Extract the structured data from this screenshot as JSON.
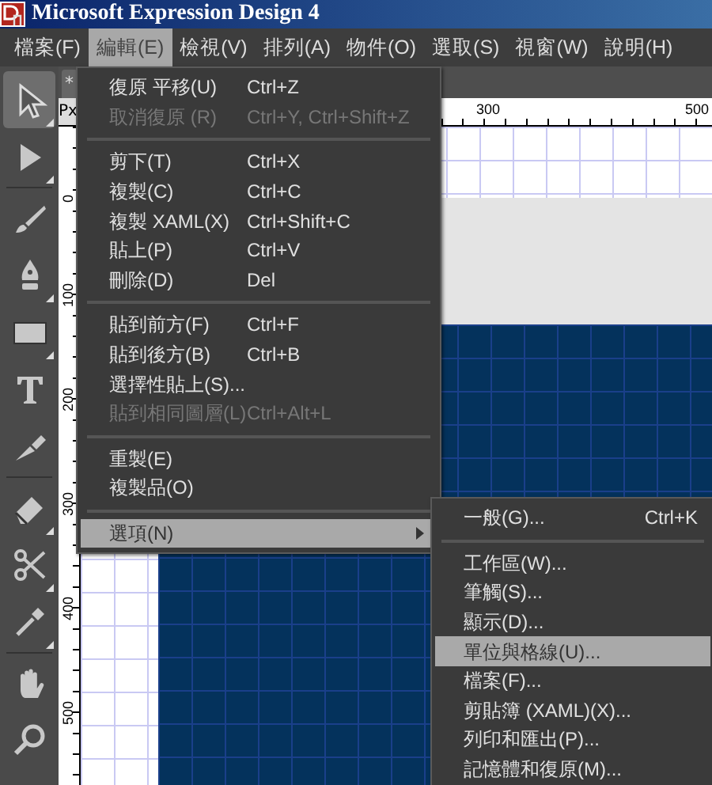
{
  "window": {
    "title": "Microsoft Expression Design 4"
  },
  "menubar": [
    {
      "label": "檔案(F)",
      "selected": false
    },
    {
      "label": "編輯(E)",
      "selected": true
    },
    {
      "label": "檢視(V)",
      "selected": false
    },
    {
      "label": "排列(A)",
      "selected": false
    },
    {
      "label": "物件(O)",
      "selected": false
    },
    {
      "label": "選取(S)",
      "selected": false
    },
    {
      "label": "視窗(W)",
      "selected": false
    },
    {
      "label": "說明(H)",
      "selected": false
    }
  ],
  "toolbox": [
    {
      "kind": "select",
      "selected": true,
      "flyout": true
    },
    {
      "kind": "direct",
      "selected": false,
      "flyout": true
    },
    {
      "kind": "divider"
    },
    {
      "kind": "brush",
      "selected": false,
      "flyout": false
    },
    {
      "kind": "pen",
      "selected": false,
      "flyout": true
    },
    {
      "kind": "rectangle",
      "selected": false,
      "flyout": true
    },
    {
      "kind": "text",
      "selected": false,
      "flyout": false
    },
    {
      "kind": "knife",
      "selected": false,
      "flyout": false
    },
    {
      "kind": "divider"
    },
    {
      "kind": "gradient",
      "selected": false,
      "flyout": true
    },
    {
      "kind": "scissors",
      "selected": false,
      "flyout": true
    },
    {
      "kind": "eyedropper",
      "selected": false,
      "flyout": true
    },
    {
      "kind": "divider"
    },
    {
      "kind": "hand",
      "selected": false,
      "flyout": false
    },
    {
      "kind": "zoom",
      "selected": false,
      "flyout": false
    }
  ],
  "document_tab": {
    "label": "*"
  },
  "ruler": {
    "unit": "Px",
    "top_labels": [
      "300",
      "500"
    ],
    "left_labels": [
      "0",
      "100",
      "200",
      "300",
      "400",
      "500"
    ]
  },
  "edit_menu": [
    {
      "kind": "item",
      "label": "復原 平移(U)",
      "shortcut": "Ctrl+Z",
      "disabled": false,
      "selected": false
    },
    {
      "kind": "item",
      "label": "取消復原 (R)",
      "shortcut": "Ctrl+Y, Ctrl+Shift+Z",
      "disabled": true,
      "selected": false
    },
    {
      "kind": "separator"
    },
    {
      "kind": "item",
      "label": "剪下(T)",
      "shortcut": "Ctrl+X",
      "disabled": false,
      "selected": false
    },
    {
      "kind": "item",
      "label": "複製(C)",
      "shortcut": "Ctrl+C",
      "disabled": false,
      "selected": false
    },
    {
      "kind": "item",
      "label": "複製 XAML(X)",
      "shortcut": "Ctrl+Shift+C",
      "disabled": false,
      "selected": false
    },
    {
      "kind": "item",
      "label": "貼上(P)",
      "shortcut": "Ctrl+V",
      "disabled": false,
      "selected": false
    },
    {
      "kind": "item",
      "label": "刪除(D)",
      "shortcut": "Del",
      "disabled": false,
      "selected": false
    },
    {
      "kind": "separator"
    },
    {
      "kind": "item",
      "label": "貼到前方(F)",
      "shortcut": "Ctrl+F",
      "disabled": false,
      "selected": false
    },
    {
      "kind": "item",
      "label": "貼到後方(B)",
      "shortcut": "Ctrl+B",
      "disabled": false,
      "selected": false
    },
    {
      "kind": "item",
      "label": "選擇性貼上(S)...",
      "disabled": false,
      "selected": false
    },
    {
      "kind": "item",
      "label": "貼到相同圖層(L)",
      "shortcut": "Ctrl+Alt+L",
      "disabled": true,
      "selected": false
    },
    {
      "kind": "separator"
    },
    {
      "kind": "item",
      "label": "重製(E)",
      "disabled": false,
      "selected": false
    },
    {
      "kind": "item",
      "label": "複製品(O)",
      "disabled": false,
      "selected": false
    },
    {
      "kind": "separator"
    },
    {
      "kind": "submenu",
      "label": "選項(N)",
      "disabled": false,
      "selected": true
    }
  ],
  "options_submenu": [
    {
      "kind": "item",
      "label": "一般(G)...",
      "shortcut": "Ctrl+K",
      "selected": false
    },
    {
      "kind": "separator"
    },
    {
      "kind": "item",
      "label": "工作區(W)...",
      "selected": false
    },
    {
      "kind": "item",
      "label": "筆觸(S)...",
      "selected": false
    },
    {
      "kind": "item",
      "label": "顯示(D)...",
      "selected": false
    },
    {
      "kind": "item",
      "label": "單位與格線(U)...",
      "selected": true
    },
    {
      "kind": "item",
      "label": "檔案(F)...",
      "selected": false
    },
    {
      "kind": "item",
      "label": "剪貼簿 (XAML)(X)...",
      "selected": false
    },
    {
      "kind": "item",
      "label": "列印和匯出(P)...",
      "selected": false
    },
    {
      "kind": "item",
      "label": "記憶體和復原(M)...",
      "selected": false
    }
  ]
}
